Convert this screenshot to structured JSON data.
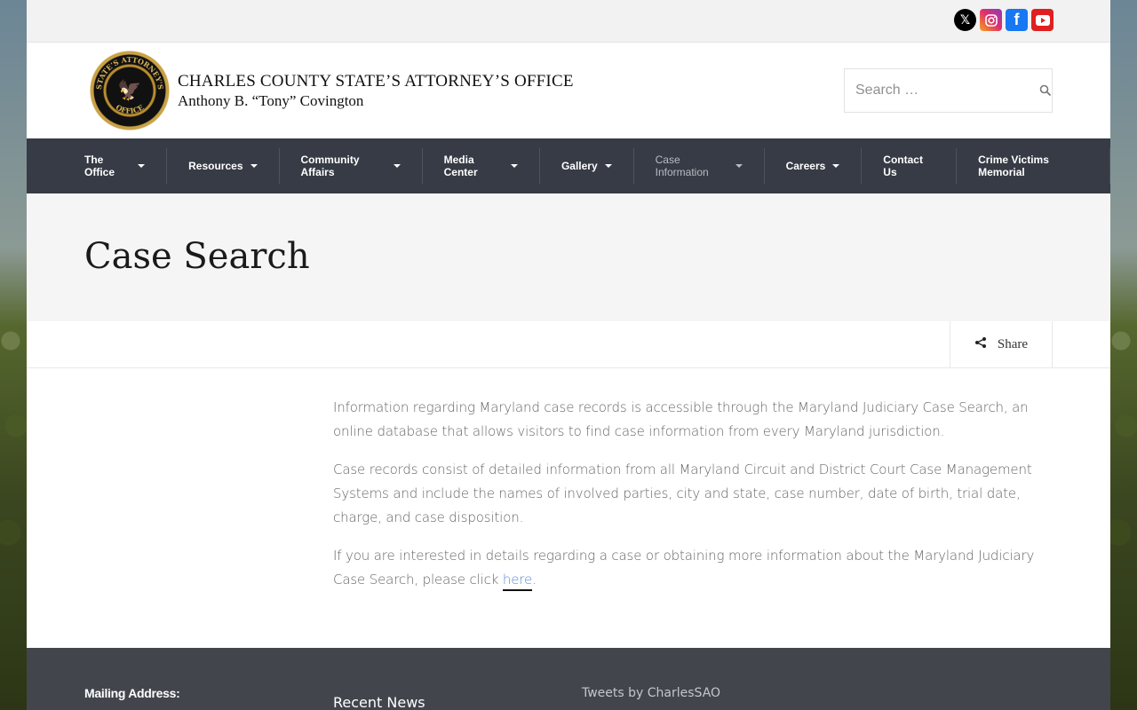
{
  "social": {
    "x_icon": "x-twitter-icon",
    "instagram_icon": "instagram-icon",
    "facebook_icon": "facebook-icon",
    "youtube_icon": "youtube-icon"
  },
  "header": {
    "org_name": "CHARLES COUNTY STATE’S ATTORNEY’S OFFICE",
    "official": "Anthony B. “Tony” Covington",
    "seal_text_top": "STATE'S ATTORNEY'S",
    "seal_text_bottom": "OFFICE",
    "search_placeholder": "Search …"
  },
  "nav": {
    "items": [
      {
        "label": "The Office",
        "dropdown": true
      },
      {
        "label": "Resources",
        "dropdown": true
      },
      {
        "label": "Community Affairs",
        "dropdown": true
      },
      {
        "label": "Media Center",
        "dropdown": true
      },
      {
        "label": "Gallery",
        "dropdown": true
      },
      {
        "label": "Case Information",
        "dropdown": true,
        "active": true
      },
      {
        "label": "Careers",
        "dropdown": true
      },
      {
        "label": "Contact Us",
        "dropdown": false
      },
      {
        "label": "Crime Victims Memorial",
        "dropdown": false
      }
    ]
  },
  "page": {
    "title": "Case Search",
    "share_label": "Share"
  },
  "content": {
    "p1": "Information regarding Maryland case records is accessible through the Maryland Judiciary Case Search, an online database that allows visitors to find case information from every Maryland jurisdiction.",
    "p2": "Case records consist of detailed information from all Maryland Circuit and District Court Case Management Systems and include the names of involved parties, city and state, case number, date of birth, trial date, charge, and case disposition.",
    "p3_before": "If you are interested in details regarding a case or obtaining more information about the Maryland Judiciary Case Search, please click ",
    "p3_link": "here",
    "p3_after": "."
  },
  "footer": {
    "mailing_label": "Mailing Address:",
    "recent_news": "Recent News",
    "tweets": "Tweets by CharlesSAO"
  },
  "colors": {
    "nav_bg": "#363b45",
    "footer_bg": "#42454c",
    "link": "#5b8bd4",
    "title_band": "#f5f5f5"
  }
}
